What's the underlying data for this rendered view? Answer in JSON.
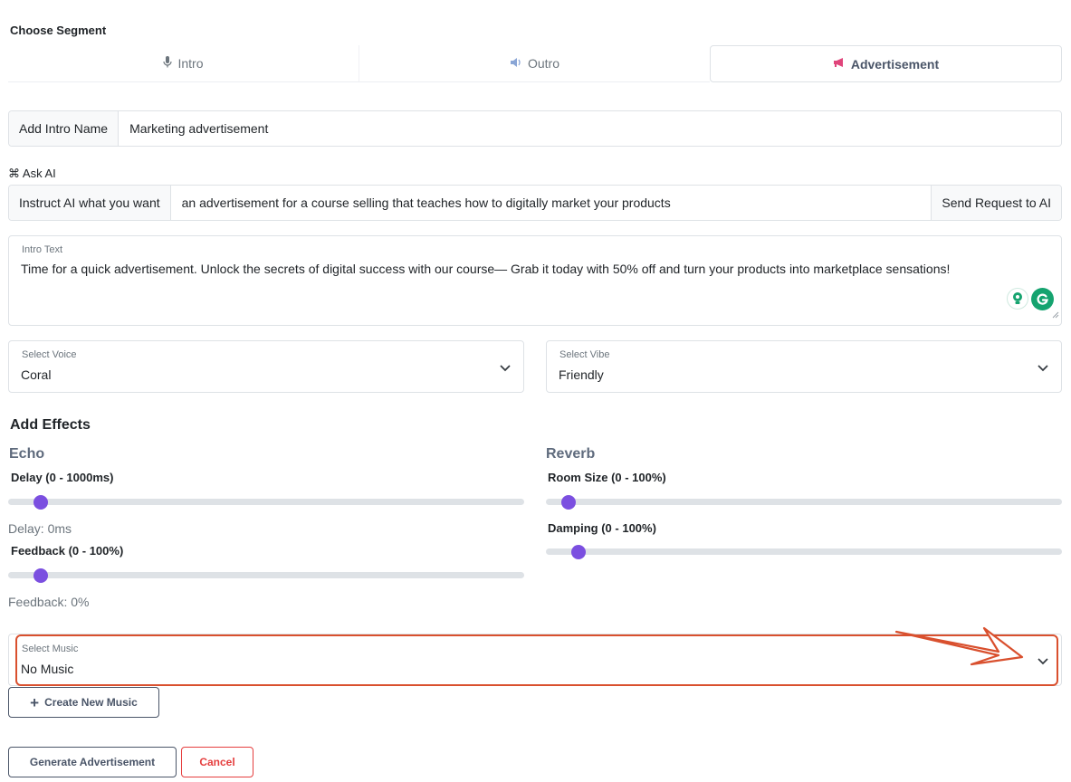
{
  "segment": {
    "heading": "Choose Segment",
    "tabs": [
      {
        "label": "Intro",
        "icon": "microphone-icon"
      },
      {
        "label": "Outro",
        "icon": "speaker-icon"
      },
      {
        "label": "Advertisement",
        "icon": "megaphone-icon"
      }
    ],
    "active_tab": "Advertisement"
  },
  "name_field": {
    "addon": "Add Intro Name",
    "value": "Marketing advertisement"
  },
  "ask_ai": {
    "label": "⌘ Ask AI",
    "addon": "Instruct AI what you want",
    "value": "an advertisement for a course selling that teaches how to digitally market your products",
    "button": "Send Request to AI"
  },
  "intro_text": {
    "label": "Intro Text",
    "value": "Time for a quick advertisement. Unlock the secrets of digital success with our course— Grab it today with 50% off and turn your products into marketplace sensations!"
  },
  "voice": {
    "label": "Select Voice",
    "value": "Coral"
  },
  "vibe": {
    "label": "Select Vibe",
    "value": "Friendly"
  },
  "effects": {
    "title": "Add Effects",
    "echo": {
      "name": "Echo",
      "delay_label": "Delay (0 - 1000ms)",
      "delay_value_text": "Delay: 0ms",
      "delay_value": 0,
      "feedback_label": "Feedback (0 - 100%)",
      "feedback_value_text": "Feedback: 0%",
      "feedback_value": 0
    },
    "reverb": {
      "name": "Reverb",
      "room_label": "Room Size (0 - 100%)",
      "room_value": 0,
      "damping_label": "Damping (0 - 100%)",
      "damping_value": 0
    }
  },
  "music": {
    "label": "Select Music",
    "value": "No Music",
    "create_button": "Create New Music"
  },
  "actions": {
    "generate": "Generate Advertisement",
    "cancel": "Cancel"
  },
  "colors": {
    "accent": "#7b4fe0",
    "annotation": "#d9502e",
    "danger": "#e53e3e",
    "grammarly": "#15a36f"
  }
}
